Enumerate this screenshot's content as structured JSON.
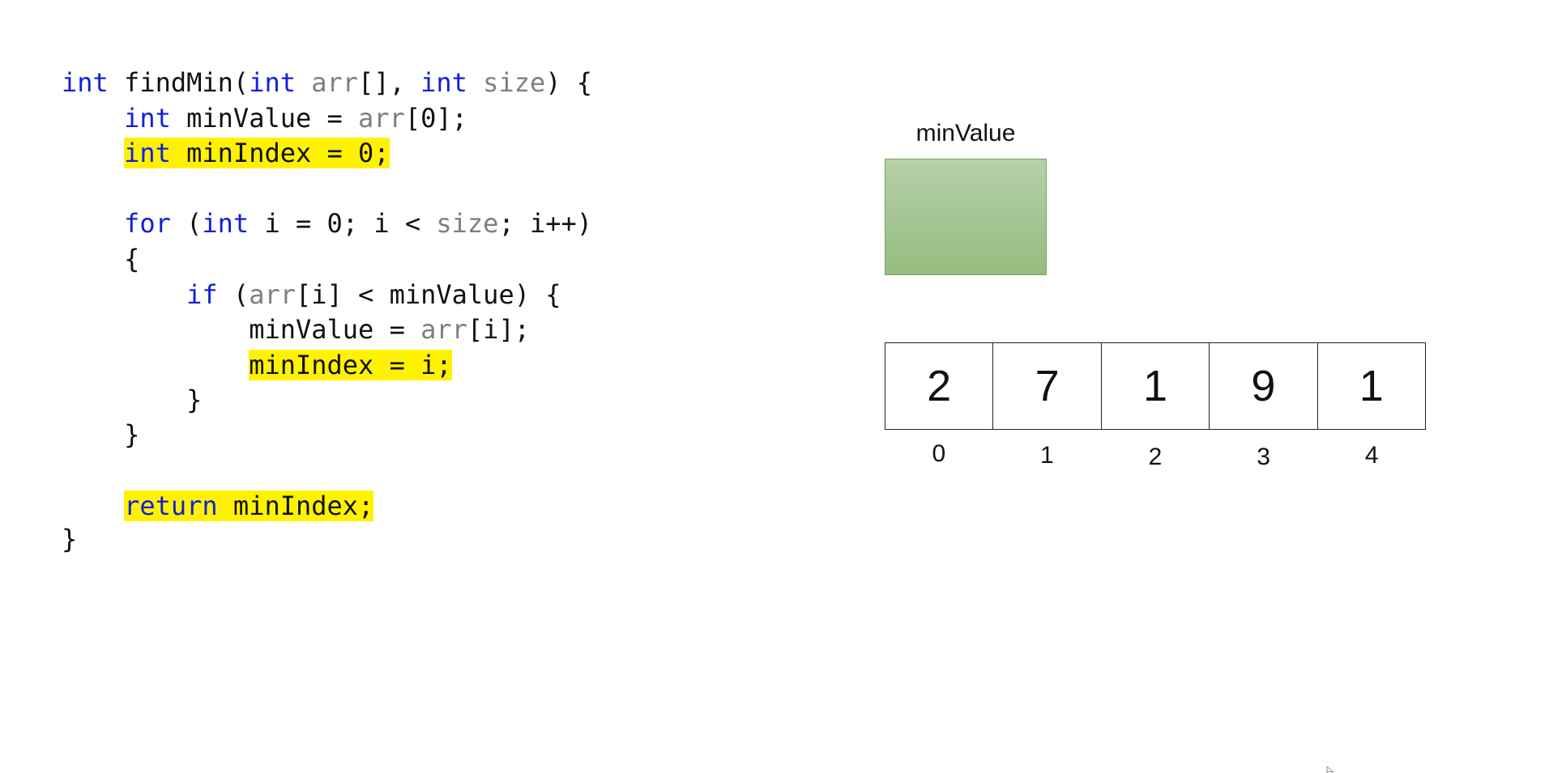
{
  "code": {
    "lines": [
      {
        "tokens": [
          {
            "t": "int",
            "k": "kw"
          },
          {
            "t": " findMin(",
            "k": "plain"
          },
          {
            "t": "int",
            "k": "kw"
          },
          {
            "t": " ",
            "k": "plain"
          },
          {
            "t": "arr",
            "k": "param"
          },
          {
            "t": "[], ",
            "k": "plain"
          },
          {
            "t": "int",
            "k": "kw"
          },
          {
            "t": " ",
            "k": "plain"
          },
          {
            "t": "size",
            "k": "param"
          },
          {
            "t": ") {",
            "k": "plain"
          }
        ]
      },
      {
        "tokens": [
          {
            "t": "    ",
            "k": "plain"
          },
          {
            "t": "int",
            "k": "kw"
          },
          {
            "t": " minValue = ",
            "k": "plain"
          },
          {
            "t": "arr",
            "k": "param"
          },
          {
            "t": "[0];",
            "k": "plain"
          }
        ]
      },
      {
        "highlighted": true,
        "tokens": [
          {
            "t": "    ",
            "k": "plain"
          },
          {
            "t": "int",
            "k": "kw"
          },
          {
            "t": " minIndex = 0;",
            "k": "plain"
          }
        ]
      },
      {
        "tokens": []
      },
      {
        "tokens": [
          {
            "t": "    ",
            "k": "plain"
          },
          {
            "t": "for",
            "k": "kw"
          },
          {
            "t": " (",
            "k": "plain"
          },
          {
            "t": "int",
            "k": "kw"
          },
          {
            "t": " i = 0; i < ",
            "k": "plain"
          },
          {
            "t": "size",
            "k": "param"
          },
          {
            "t": "; i++)",
            "k": "plain"
          }
        ]
      },
      {
        "tokens": [
          {
            "t": "    {",
            "k": "plain"
          }
        ]
      },
      {
        "tokens": [
          {
            "t": "        ",
            "k": "plain"
          },
          {
            "t": "if",
            "k": "kw"
          },
          {
            "t": " (",
            "k": "plain"
          },
          {
            "t": "arr",
            "k": "param"
          },
          {
            "t": "[i] < minValue) {",
            "k": "plain"
          }
        ]
      },
      {
        "tokens": [
          {
            "t": "            minValue = ",
            "k": "plain"
          },
          {
            "t": "arr",
            "k": "param"
          },
          {
            "t": "[i];",
            "k": "plain"
          }
        ]
      },
      {
        "highlighted": true,
        "tokens": [
          {
            "t": "            ",
            "k": "plain"
          },
          {
            "t": "minIndex = i;",
            "k": "plain"
          }
        ]
      },
      {
        "tokens": [
          {
            "t": "        }",
            "k": "plain"
          }
        ]
      },
      {
        "tokens": [
          {
            "t": "    }",
            "k": "plain"
          }
        ]
      },
      {
        "tokens": []
      },
      {
        "highlighted": true,
        "tokens": [
          {
            "t": "    ",
            "k": "plain"
          },
          {
            "t": "return",
            "k": "kw"
          },
          {
            "t": " minIndex;",
            "k": "plain"
          }
        ]
      },
      {
        "tokens": [
          {
            "t": "}",
            "k": "plain"
          }
        ]
      }
    ]
  },
  "variable": {
    "label": "minValue",
    "value": ""
  },
  "array": {
    "values": [
      "2",
      "7",
      "1",
      "9",
      "1"
    ],
    "indices": [
      "0",
      "1",
      "2",
      "3",
      "4"
    ]
  },
  "colors": {
    "keyword": "#1520d6",
    "parameter": "#7f7f7f",
    "highlight": "#fff200",
    "variable_box": "#a6c894"
  }
}
